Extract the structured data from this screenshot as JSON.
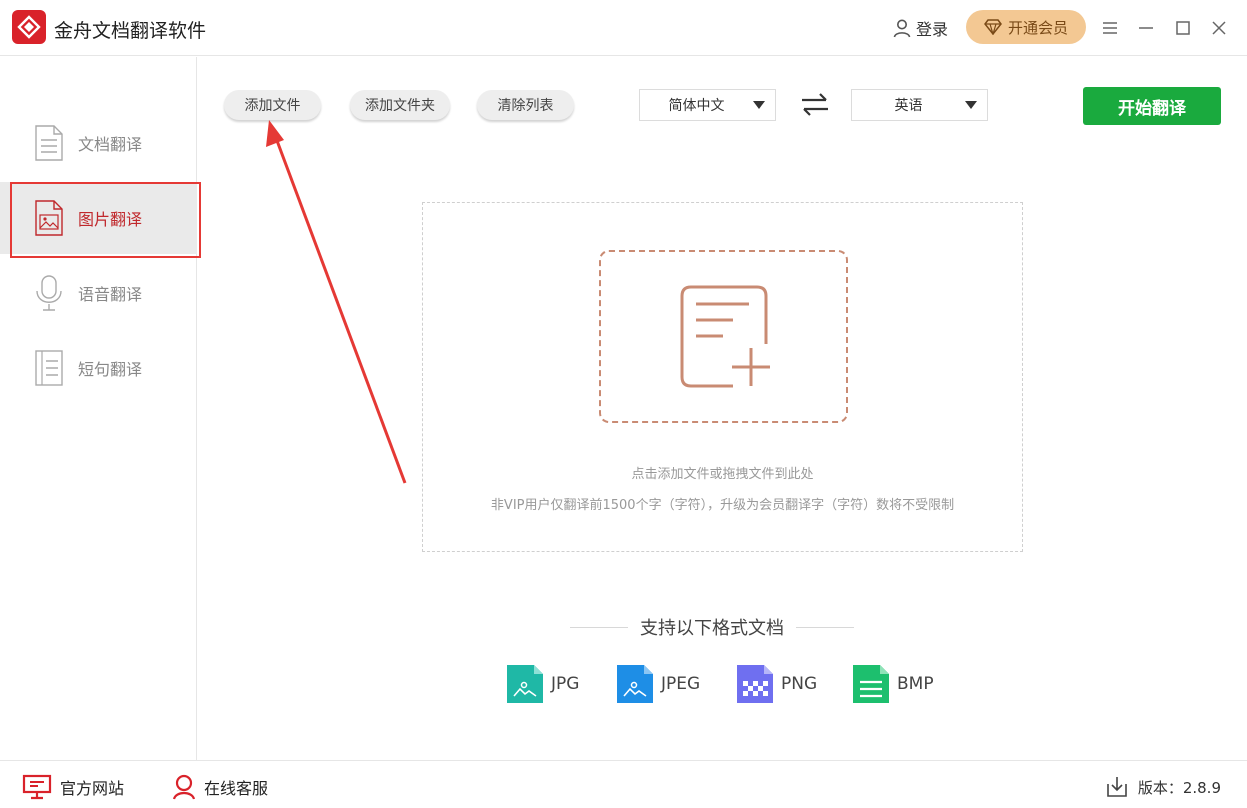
{
  "app": {
    "title": "金舟文档翻译软件"
  },
  "header": {
    "login_label": "登录",
    "vip_label": "开通会员"
  },
  "sidebar": {
    "items": [
      {
        "label": "文档翻译",
        "icon": "document-icon",
        "active": false
      },
      {
        "label": "图片翻译",
        "icon": "image-icon",
        "active": true
      },
      {
        "label": "语音翻译",
        "icon": "microphone-icon",
        "active": false
      },
      {
        "label": "短句翻译",
        "icon": "text-lines-icon",
        "active": false
      }
    ]
  },
  "toolbar": {
    "add_file": "添加文件",
    "add_folder": "添加文件夹",
    "clear_list": "清除列表",
    "source_lang": "简体中文",
    "target_lang": "英语",
    "start": "开始翻译"
  },
  "dropzone": {
    "hint": "点击添加文件或拖拽文件到此处",
    "note": "非VIP用户仅翻译前1500个字（字符），升级为会员翻译字（字符）数将不受限制"
  },
  "formats": {
    "title": "支持以下格式文档",
    "items": [
      {
        "label": "JPG",
        "color": "#1fb8a6"
      },
      {
        "label": "JPEG",
        "color": "#1e8ee6"
      },
      {
        "label": "PNG",
        "color": "#6f6ff0"
      },
      {
        "label": "BMP",
        "color": "#1dbf6e"
      }
    ]
  },
  "footer": {
    "website": "官方网站",
    "support": "在线客服",
    "version": "版本：2.8.9"
  },
  "colors": {
    "accent_red": "#e53935",
    "start_green": "#1aaa3e",
    "vip_gold": "#f3c893",
    "drop_border": "#c98b73"
  }
}
